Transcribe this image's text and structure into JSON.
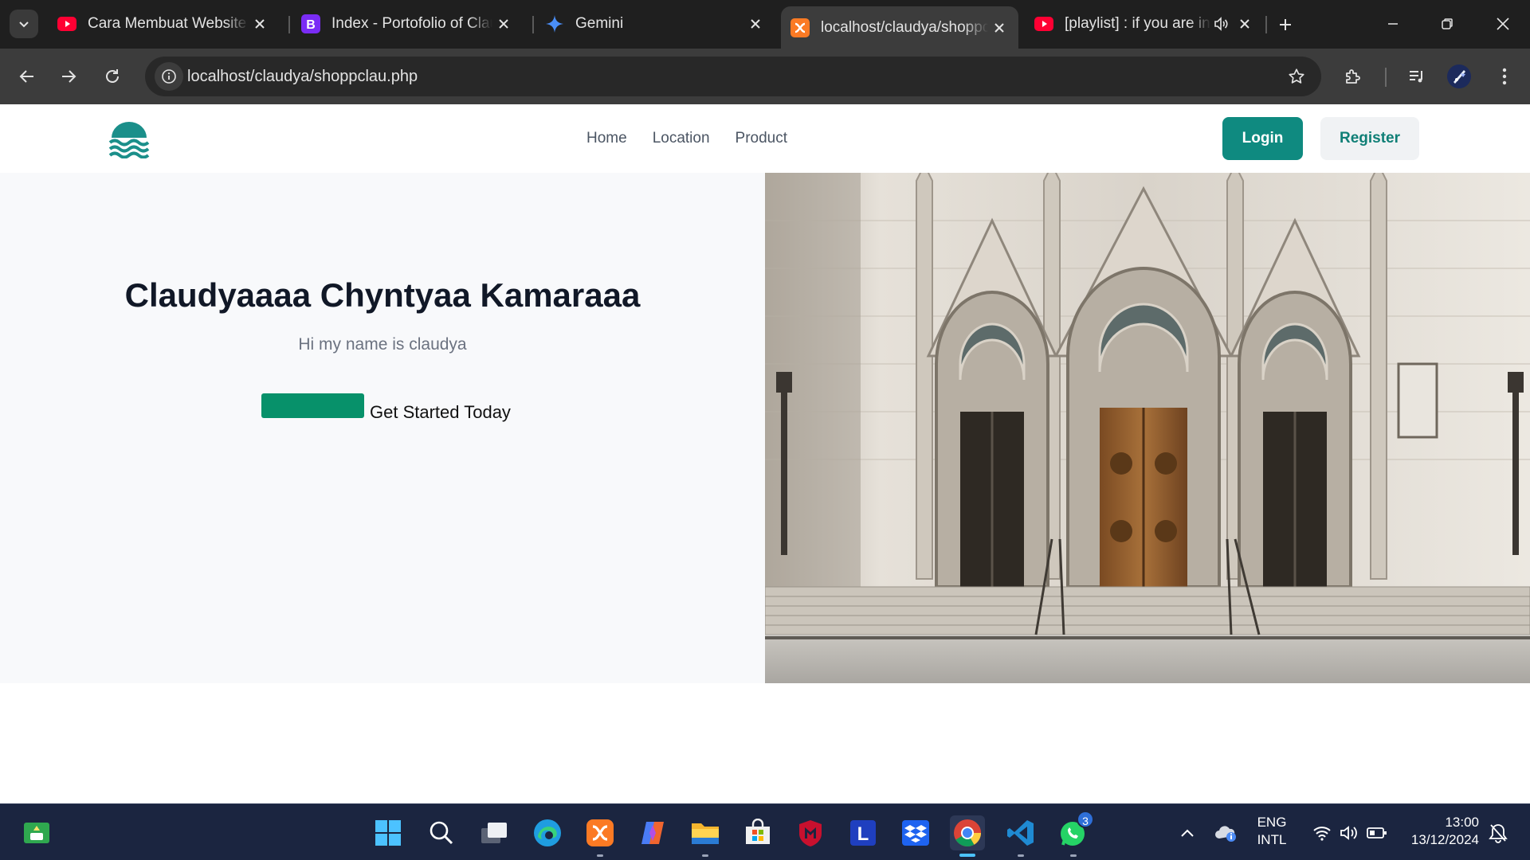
{
  "browser": {
    "tabs": [
      {
        "title": "Cara Membuat Website P",
        "favicon": "youtube-icon",
        "active": false
      },
      {
        "title": "Index - Portofolio of Clau",
        "favicon": "bootstrap-icon",
        "active": false
      },
      {
        "title": "Gemini",
        "favicon": "gemini-icon",
        "active": false
      },
      {
        "title": "localhost/claudya/shoppc",
        "favicon": "xampp-icon",
        "active": true
      },
      {
        "title": "[playlist] : if you are in",
        "favicon": "youtube-icon",
        "active": false,
        "audio": true
      }
    ],
    "address_bar": {
      "url": "localhost/claudya/shoppclau.php"
    },
    "colors": {
      "tab_strip": "#1f1f1f",
      "toolbar": "#3c3c3c",
      "omnibox": "#282828"
    }
  },
  "site": {
    "nav": {
      "links": [
        "Home",
        "Location",
        "Product"
      ],
      "login_label": "Login",
      "register_label": "Register"
    },
    "hero": {
      "title": "Claudyaaaa Chyntyaa Kamaraaa",
      "subtitle": "Hi my name is claudya",
      "cta_label": "Get Started Today",
      "image": "cathedral-facade-photo"
    },
    "colors": {
      "brand": "#0f8a80",
      "cta_swatch": "#07916a",
      "hero_bg": "#f8f9fb"
    }
  },
  "taskbar": {
    "apps": [
      "windows-start-icon",
      "search-icon",
      "task-view-icon",
      "edge-icon",
      "xampp-icon",
      "copilot-icon",
      "file-explorer-icon",
      "microsoft-store-icon",
      "mcafee-icon",
      "l-app-icon",
      "dropbox-icon",
      "chrome-icon",
      "vscode-icon",
      "whatsapp-icon"
    ],
    "whatsapp_badge": "3",
    "language": {
      "line1": "ENG",
      "line2": "INTL"
    },
    "clock": {
      "time": "13:00",
      "date": "13/12/2024"
    }
  }
}
